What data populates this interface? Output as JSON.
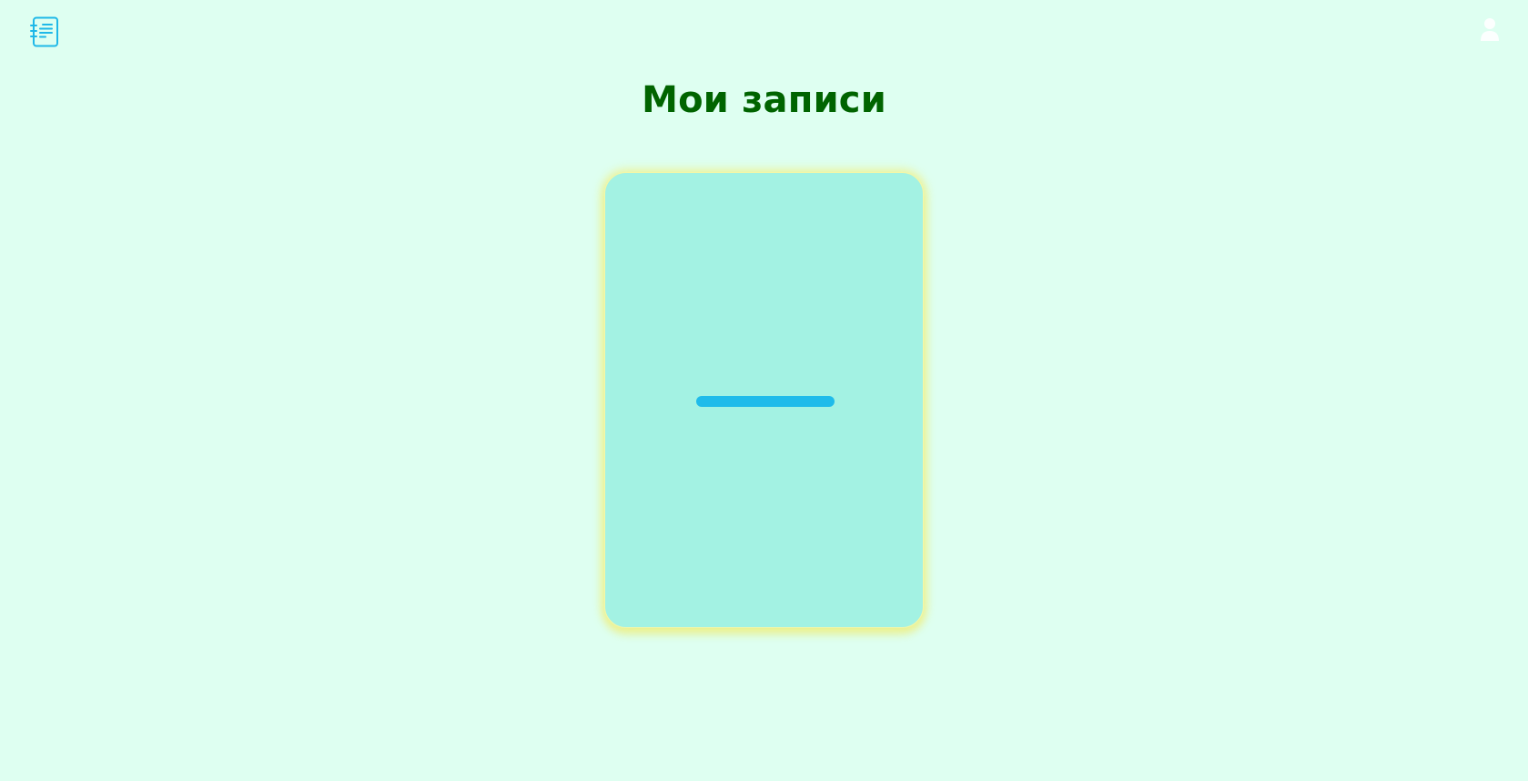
{
  "header": {
    "logo_icon": "notes-list-icon",
    "user_icon": "user-icon"
  },
  "page": {
    "title": "Мои записи"
  },
  "add_card": {
    "icon": "plus-icon"
  },
  "colors": {
    "background": "#defff1",
    "title": "#006400",
    "card": "#a3f2e3",
    "card_glow": "#f0f082",
    "accent": "#1fb8e8"
  }
}
